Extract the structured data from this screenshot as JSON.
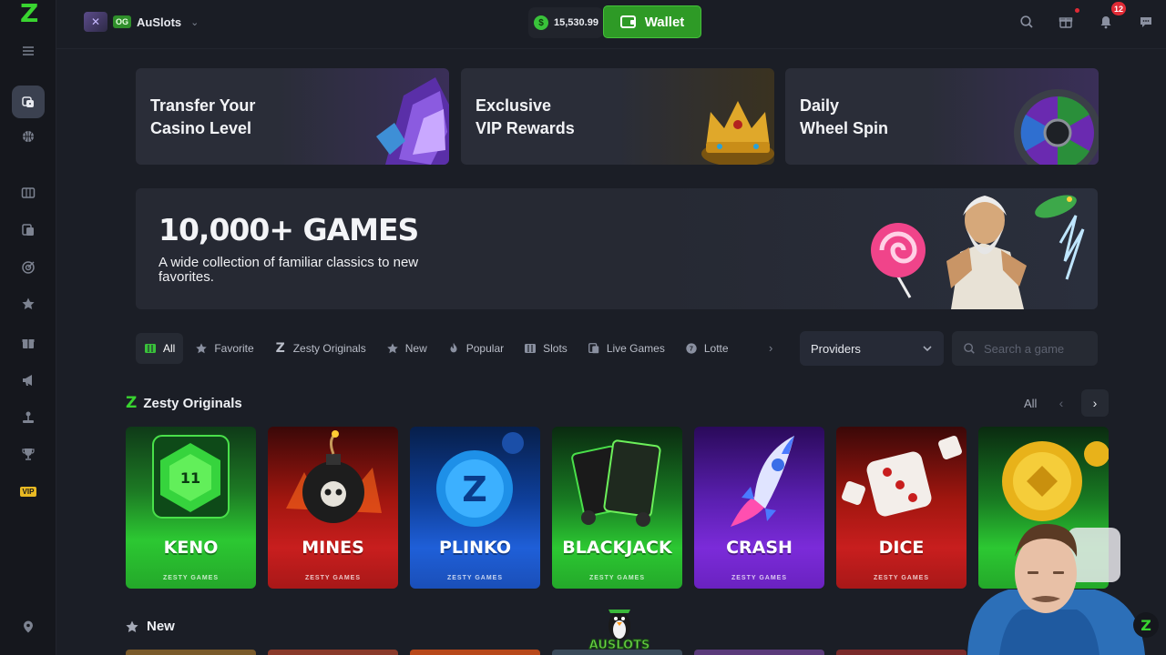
{
  "colors": {
    "accent": "#39c23a",
    "background": "#1b1e26",
    "notification": "#e02a35"
  },
  "rail": {
    "logo": "Z",
    "items": [
      {
        "icon": "menu-icon"
      },
      {
        "icon": "casino-dice-icon",
        "active": true
      },
      {
        "icon": "sports-ball-icon"
      },
      {
        "icon": "slots-icon"
      },
      {
        "icon": "live-games-icon"
      },
      {
        "icon": "target-icon"
      },
      {
        "icon": "star-icon"
      },
      {
        "icon": "gift-icon"
      },
      {
        "icon": "megaphone-icon"
      },
      {
        "icon": "joystick-icon"
      },
      {
        "icon": "trophy-icon"
      },
      {
        "icon": "vip-icon",
        "label": "VIP"
      },
      {
        "icon": "location-pin-icon"
      }
    ]
  },
  "topbar": {
    "brand": {
      "badge": "OG",
      "name": "AuSlots"
    },
    "balance": {
      "currency_symbol": "$",
      "amount": "15,530.99"
    },
    "wallet_label": "Wallet",
    "notification_count": "12"
  },
  "promos": [
    {
      "title": "Transfer Your\nCasino Level",
      "art": "crystal-cards"
    },
    {
      "title": "Exclusive\nVIP Rewards",
      "art": "gold-crown"
    },
    {
      "title": "Daily\nWheel Spin",
      "art": "prize-wheel"
    }
  ],
  "hero": {
    "title": "10,000+ GAMES",
    "subtitle": "A wide collection of familiar classics to new favorites."
  },
  "filters": {
    "tabs": [
      {
        "label": "All",
        "icon": "slots-icon",
        "active": true
      },
      {
        "label": "Favorite",
        "icon": "star-icon"
      },
      {
        "label": "Zesty Originals",
        "icon": "zesty-logo-icon"
      },
      {
        "label": "New",
        "icon": "sparkle-star-icon"
      },
      {
        "label": "Popular",
        "icon": "fire-icon"
      },
      {
        "label": "Slots",
        "icon": "slots-icon"
      },
      {
        "label": "Live Games",
        "icon": "live-games-icon"
      },
      {
        "label": "Lotte",
        "icon": "lottery-ball-icon"
      }
    ],
    "providers_label": "Providers",
    "search_placeholder": "Search a game"
  },
  "zesty_originals": {
    "title": "Zesty Originals",
    "all_label": "All",
    "games": [
      {
        "title": "KENO",
        "studio": "ZESTY GAMES",
        "number": "11",
        "color": "#2cc832"
      },
      {
        "title": "MINES",
        "studio": "ZESTY GAMES",
        "color": "#c81e1e"
      },
      {
        "title": "PLINKO",
        "studio": "ZESTY GAMES",
        "color": "#1f5fd8"
      },
      {
        "title": "BLACKJACK",
        "studio": "ZESTY GAMES",
        "color": "#2cc832"
      },
      {
        "title": "CRASH",
        "studio": "ZESTY GAMES",
        "color": "#7b2bd9"
      },
      {
        "title": "DICE",
        "studio": "ZESTY GAMES",
        "color": "#c81e1e"
      },
      {
        "title": "",
        "studio": "",
        "color": "#2cc832"
      }
    ]
  },
  "new_section": {
    "title": "New"
  },
  "watermark": "AUSLOTS"
}
